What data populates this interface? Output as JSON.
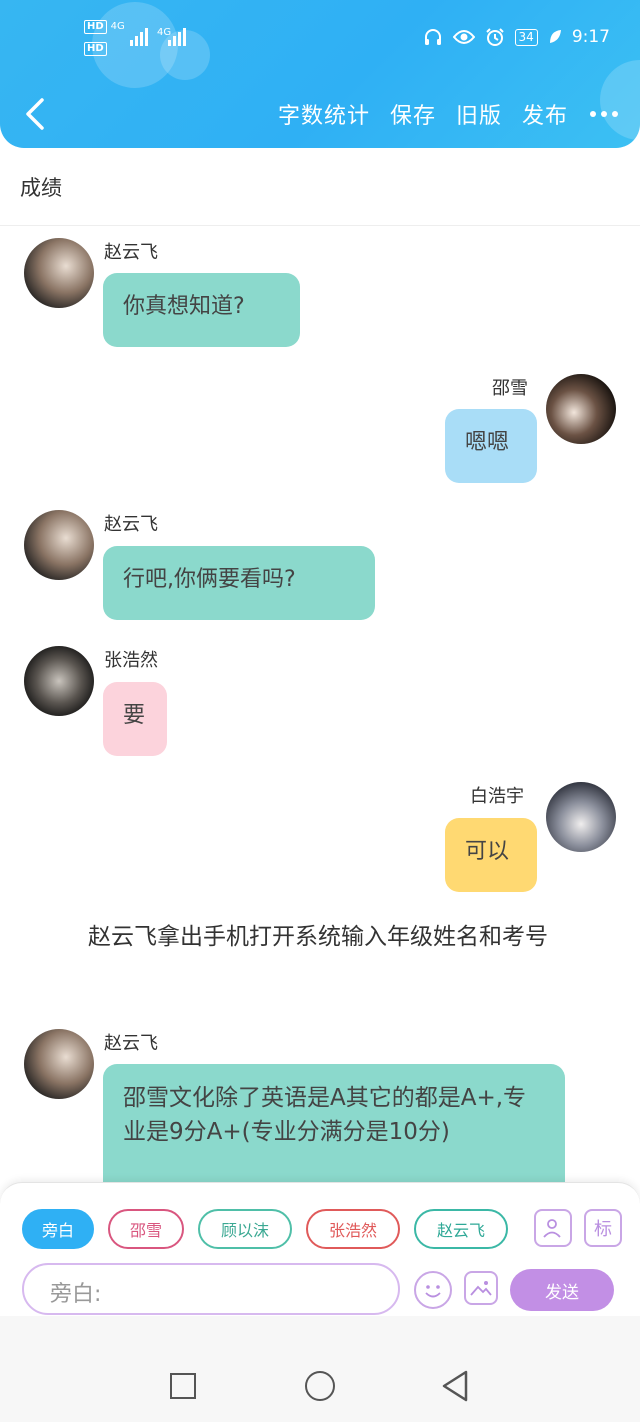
{
  "status_bar": {
    "time": "9:17",
    "battery": "34",
    "network_1": "4G",
    "network_2": "4G",
    "hd_1": "HD",
    "hd_2": "HD"
  },
  "toolbar": {
    "word_count": "字数统计",
    "save": "保存",
    "old_version": "旧版",
    "publish": "发布"
  },
  "page": {
    "title": "成绩"
  },
  "messages": [
    {
      "speaker": "赵云飞",
      "text": "你真想知道?"
    },
    {
      "speaker": "邵雪",
      "text": "嗯嗯"
    },
    {
      "speaker": "赵云飞",
      "text": "行吧,你俩要看吗?"
    },
    {
      "speaker": "张浩然",
      "text": "要"
    },
    {
      "speaker": "白浩宇",
      "text": "可以"
    },
    {
      "narration": "赵云飞拿出手机打开系统输入年级姓名和考号"
    },
    {
      "speaker": "赵云飞",
      "text": "邵雪文化除了英语是A其它的都是A+,专业是9分A+(专业分满分是10分)"
    }
  ],
  "character_chips": [
    {
      "label": "旁白",
      "color": "#2fb0f4",
      "selected": true
    },
    {
      "label": "邵雪",
      "color": "#d9567f",
      "selected": false
    },
    {
      "label": "顾以沫",
      "color": "#4fbfa8",
      "selected": false
    },
    {
      "label": "张浩然",
      "color": "#e05a5a",
      "selected": false
    },
    {
      "label": "赵云飞",
      "color": "#3bb8a6",
      "selected": false
    }
  ],
  "tools": {
    "tag_label": "标"
  },
  "input": {
    "placeholder": "旁白:"
  },
  "send": {
    "label": "发送"
  },
  "colors": {
    "header": "#2fb0f4",
    "accent_purple": "#c28fe5",
    "bubble_green": "#8bd9cc",
    "bubble_blue": "#a9ddf7",
    "bubble_pink": "#fcd3dc",
    "bubble_yellow": "#ffd972"
  }
}
